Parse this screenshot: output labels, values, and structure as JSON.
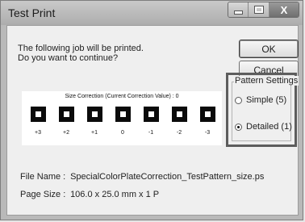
{
  "window": {
    "title": "Test Print",
    "close_symbol": "X"
  },
  "message": {
    "line1": "The following job will be printed.",
    "line2": "Do you want to continue?"
  },
  "buttons": {
    "ok": "OK",
    "cancel": "Cancel"
  },
  "pattern_settings": {
    "label": "Pattern Settings",
    "options": [
      {
        "label": "Simple (5)",
        "selected": false
      },
      {
        "label": "Detailed (1)",
        "selected": true
      }
    ]
  },
  "preview": {
    "title": "Size Correction (Current Correction Value) :  0",
    "labels": [
      "+3",
      "+2",
      "+1",
      "0",
      "-1",
      "-2",
      "-3"
    ]
  },
  "info": {
    "file_label": "File Name :",
    "file_value": "SpecialColorPlateCorrection_TestPattern_size.ps",
    "page_label": "Page Size :",
    "page_value": "106.0 x 25.0 mm x 1 P"
  }
}
